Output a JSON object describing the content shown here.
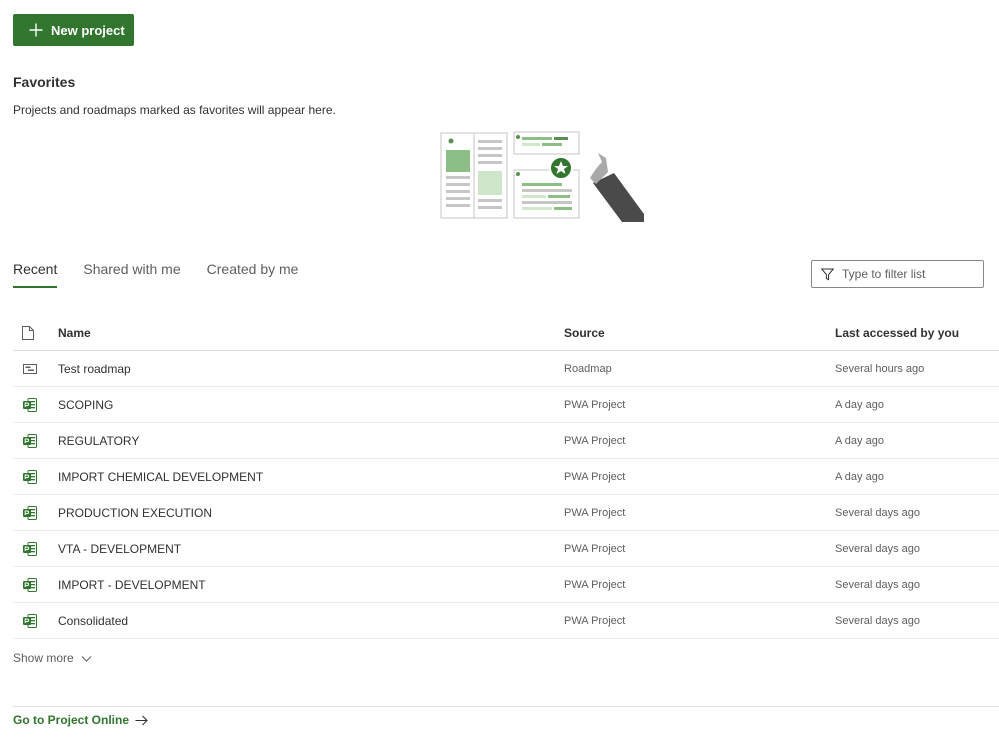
{
  "toolbar": {
    "new_project_label": "New project"
  },
  "favorites": {
    "title": "Favorites",
    "description": "Projects and roadmaps marked as favorites will appear here."
  },
  "tabs": [
    {
      "label": "Recent",
      "active": true
    },
    {
      "label": "Shared with me",
      "active": false
    },
    {
      "label": "Created by me",
      "active": false
    }
  ],
  "filter": {
    "placeholder": "Type to filter list",
    "value": ""
  },
  "table": {
    "columns": {
      "name": "Name",
      "source": "Source",
      "last_accessed": "Last accessed by you"
    },
    "rows": [
      {
        "icon": "roadmap-icon",
        "name": "Test roadmap",
        "source": "Roadmap",
        "last_accessed": "Several hours ago"
      },
      {
        "icon": "project-icon",
        "name": "SCOPING",
        "source": "PWA Project",
        "last_accessed": "A day ago"
      },
      {
        "icon": "project-icon",
        "name": "REGULATORY",
        "source": "PWA Project",
        "last_accessed": "A day ago"
      },
      {
        "icon": "project-icon",
        "name": "IMPORT CHEMICAL DEVELOPMENT",
        "source": "PWA Project",
        "last_accessed": "A day ago"
      },
      {
        "icon": "project-icon",
        "name": "PRODUCTION EXECUTION",
        "source": "PWA Project",
        "last_accessed": "Several days ago"
      },
      {
        "icon": "project-icon",
        "name": "VTA - DEVELOPMENT",
        "source": "PWA Project",
        "last_accessed": "Several days ago"
      },
      {
        "icon": "project-icon",
        "name": "IMPORT - DEVELOPMENT",
        "source": "PWA Project",
        "last_accessed": "Several days ago"
      },
      {
        "icon": "project-icon",
        "name": "Consolidated",
        "source": "PWA Project",
        "last_accessed": "Several days ago"
      }
    ]
  },
  "show_more_label": "Show more",
  "goto_label": "Go to Project Online",
  "colors": {
    "brand": "#31752f",
    "text": "#323130",
    "secondary_text": "#605e5c",
    "divider": "#e1dfdd"
  }
}
